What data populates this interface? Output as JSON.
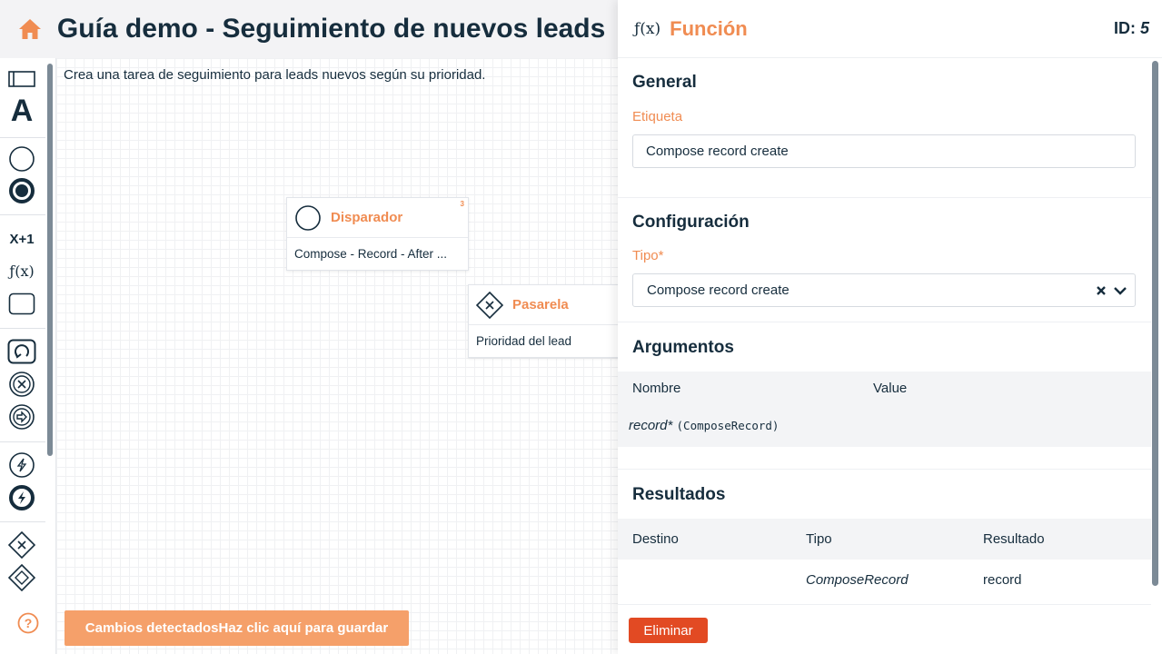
{
  "header": {
    "title": "Guía demo - Seguimiento de nuevos leads"
  },
  "toolbox": {
    "items": [
      {
        "icon": "swimlane-icon"
      },
      {
        "icon": "text-icon",
        "label": "A"
      },
      {
        "icon": "start-event-icon"
      },
      {
        "icon": "end-event-icon"
      },
      {
        "icon": "expression-icon",
        "label": "X+1"
      },
      {
        "icon": "function-icon",
        "label": "ƒ(x)"
      },
      {
        "icon": "task-icon"
      },
      {
        "icon": "loop-icon"
      },
      {
        "icon": "error-event-icon"
      },
      {
        "icon": "continue-event-icon"
      },
      {
        "icon": "trigger-event-icon"
      },
      {
        "icon": "trigger-end-icon"
      },
      {
        "icon": "exclusive-gateway-icon"
      },
      {
        "icon": "parallel-gateway-icon"
      }
    ],
    "help_icon": "question-circle-icon"
  },
  "canvas": {
    "description": "Crea una tarea de seguimiento para leads nuevos según su prioridad.",
    "nodes": [
      {
        "title": "Disparador",
        "body": "Compose - Record - After ...",
        "badge": "3"
      },
      {
        "title": "Pasarela",
        "body": "Prioridad del lead"
      }
    ],
    "save_bar": "Cambios detectadosHaz clic aquí para guardar"
  },
  "panel": {
    "fx_label": "ƒ(x)",
    "title": "Función",
    "id_label": "ID:",
    "id_value": "5",
    "general": {
      "title": "General",
      "label_label": "Etiqueta",
      "label_value": "Compose record create"
    },
    "config": {
      "title": "Configuración",
      "type_label": "Tipo*",
      "type_value": "Compose record create"
    },
    "arguments": {
      "title": "Argumentos",
      "columns": [
        "Nombre",
        "Value"
      ],
      "rows": [
        {
          "name": "record*",
          "type": "(ComposeRecord)"
        }
      ]
    },
    "results": {
      "title": "Resultados",
      "columns": [
        "Destino",
        "Tipo",
        "Resultado"
      ],
      "rows": [
        {
          "target": "",
          "type": "ComposeRecord",
          "result": "record"
        }
      ]
    },
    "delete_label": "Eliminar"
  },
  "colors": {
    "accent": "#f08c52",
    "text": "#162d3d",
    "danger": "#e24a23",
    "save_bar": "#f5a06a"
  }
}
